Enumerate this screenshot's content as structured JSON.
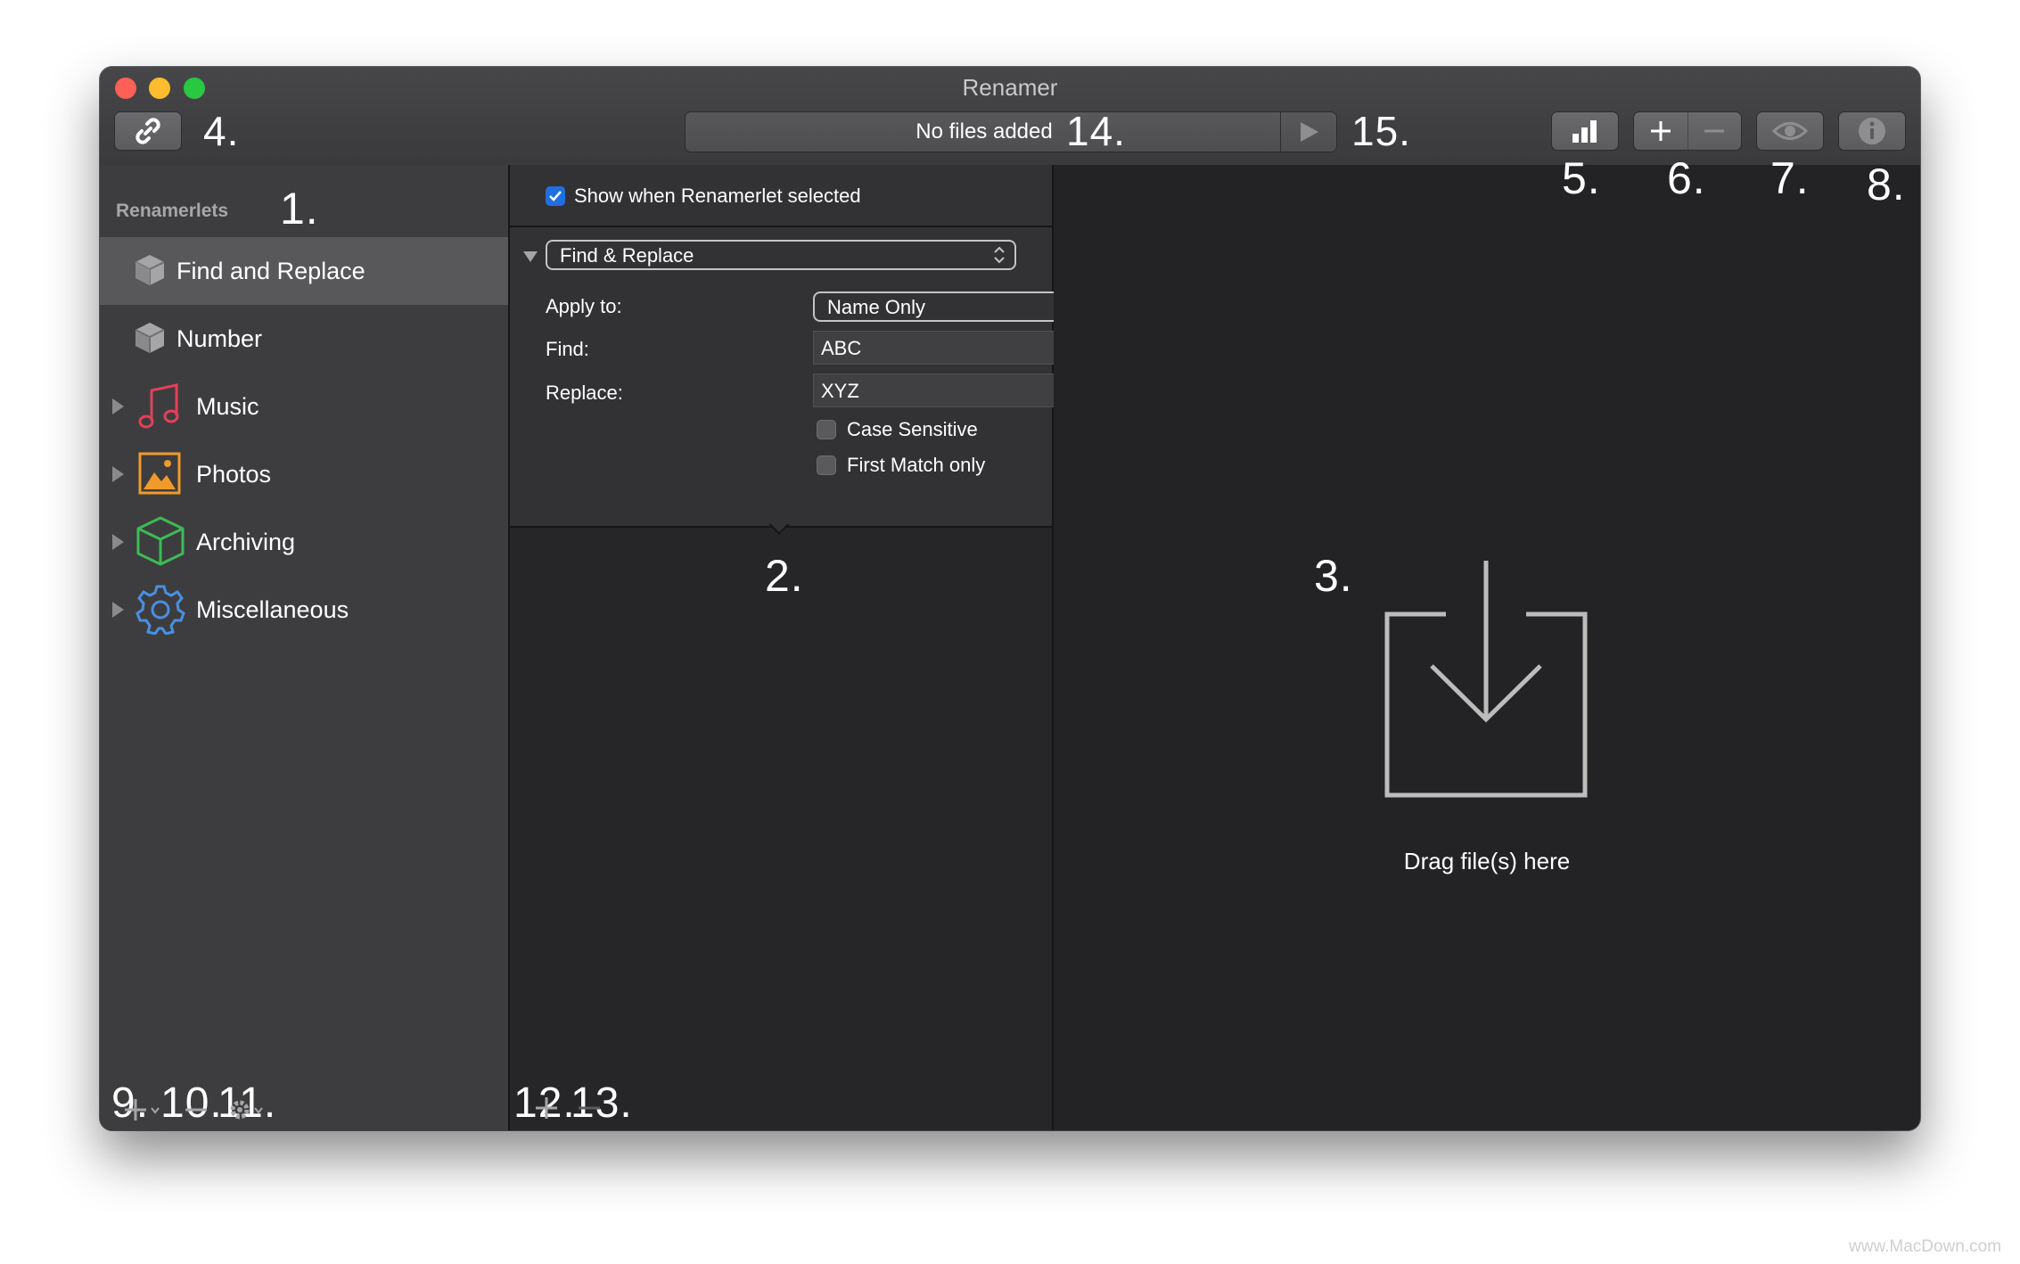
{
  "window": {
    "title": "Renamer"
  },
  "toolbar": {
    "status_text": "No files added",
    "link_button": "link-icon",
    "stats_button": "bar-chart-icon",
    "add_button": "plus-icon",
    "remove_button": "minus-icon",
    "preview_button": "eye-icon",
    "info_button": "info-icon"
  },
  "sidebar": {
    "header": "Renamerlets",
    "items": [
      {
        "label": "Find and Replace",
        "icon": "cube-icon",
        "selected": true,
        "expandable": false
      },
      {
        "label": "Number",
        "icon": "cube-icon",
        "selected": false,
        "expandable": false
      },
      {
        "label": "Music",
        "icon": "music-note-icon",
        "selected": false,
        "expandable": true
      },
      {
        "label": "Photos",
        "icon": "photo-icon",
        "selected": false,
        "expandable": true
      },
      {
        "label": "Archiving",
        "icon": "box-icon",
        "selected": false,
        "expandable": true
      },
      {
        "label": "Miscellaneous",
        "icon": "gear-icon",
        "selected": false,
        "expandable": true
      }
    ]
  },
  "editor": {
    "show_when_selected": {
      "label": "Show when Renamerlet selected",
      "checked": true
    },
    "renamerlet_select": "Find & Replace",
    "apply_to": {
      "label": "Apply to:",
      "value": "Name Only"
    },
    "find": {
      "label": "Find:",
      "value": "ABC"
    },
    "replace": {
      "label": "Replace:",
      "value": "XYZ"
    },
    "case_sensitive": {
      "label": "Case Sensitive",
      "checked": false
    },
    "first_match_only": {
      "label": "First Match only",
      "checked": false
    }
  },
  "dropzone": {
    "text": "Drag file(s) here"
  },
  "callouts": {
    "c1": "1.",
    "c2": "2.",
    "c3": "3.",
    "c4": "4.",
    "c5": "5.",
    "c6": "6.",
    "c7": "7.",
    "c8": "8.",
    "c9": "9.",
    "c10": "10.",
    "c11": "11.",
    "c12": "12.",
    "c13": "13.",
    "c14": "14.",
    "c15": "15."
  },
  "watermark": "www.MacDown.com",
  "colors": {
    "accent": "#1f6fe0",
    "window_bg": "#262628",
    "sidebar_bg": "#3d3d3f",
    "selection": "#58585a"
  }
}
